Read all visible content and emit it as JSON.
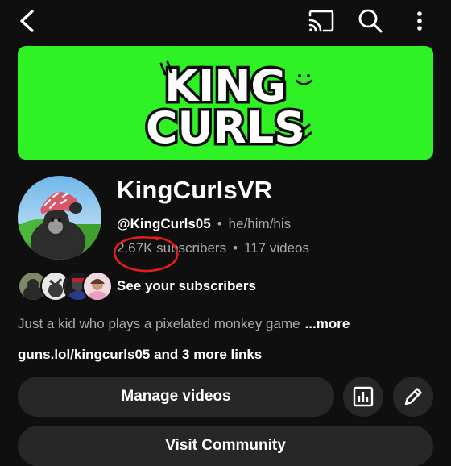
{
  "topbar": {
    "back_icon": "back-arrow-icon",
    "cast_icon": "cast-icon",
    "search_icon": "search-icon",
    "more_icon": "more-vertical-icon"
  },
  "banner": {
    "text_line1": "KING",
    "text_line2": "CURLS",
    "color": "#2ef224"
  },
  "channel": {
    "name": "KingCurlsVR",
    "handle": "@KingCurls05",
    "separator": "•",
    "pronouns": "he/him/his",
    "subscribers": "2.67K subscribers",
    "videos": "117 videos"
  },
  "subscribers_row": {
    "label": "See your subscribers"
  },
  "description": {
    "text": "Just a kid who plays a pixelated monkey game",
    "more": "...more"
  },
  "links": {
    "text": "guns.lol/kingcurls05 and 3 more links"
  },
  "actions": {
    "manage_videos": "Manage videos",
    "analytics_icon": "analytics-icon",
    "edit_icon": "edit-pencil-icon",
    "visit_community": "Visit Community"
  },
  "colors": {
    "background": "#0f0f0f",
    "button": "#272727",
    "annotation": "#e0201c"
  }
}
